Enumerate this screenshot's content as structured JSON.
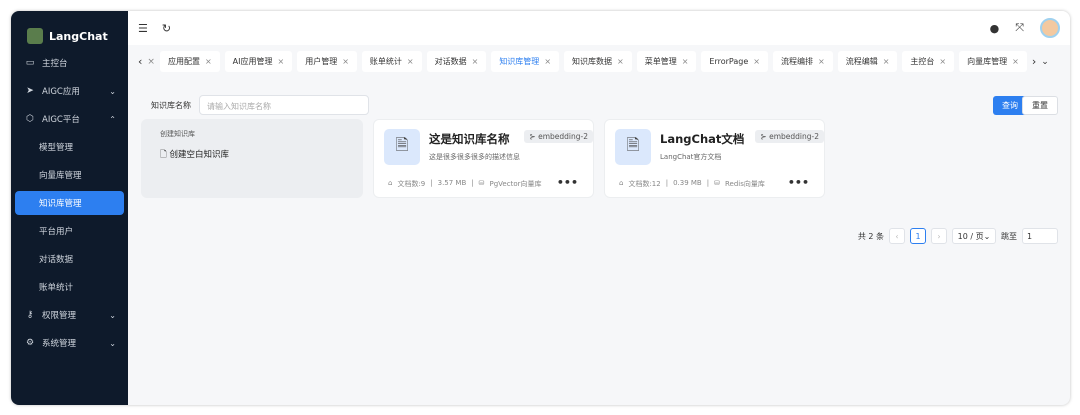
{
  "app": {
    "title": "LangChat"
  },
  "sidebar": {
    "items": [
      {
        "label": "主控台",
        "icon": "inbox-icon"
      },
      {
        "label": "AIGC应用",
        "icon": "send-icon",
        "chevron": "⌄"
      },
      {
        "label": "AIGC平台",
        "icon": "cube-icon",
        "chevron": "⌃"
      },
      {
        "label": "模型管理"
      },
      {
        "label": "向量库管理"
      },
      {
        "label": "知识库管理",
        "active": true
      },
      {
        "label": "平台用户"
      },
      {
        "label": "对话数据"
      },
      {
        "label": "账单统计"
      },
      {
        "label": "权限管理",
        "icon": "key-icon",
        "chevron": "⌄"
      },
      {
        "label": "系统管理",
        "icon": "gear-icon",
        "chevron": "⌄"
      }
    ]
  },
  "tabs": [
    "应用配置",
    "AI应用管理",
    "用户管理",
    "账单统计",
    "对话数据",
    "知识库管理",
    "知识库数据",
    "菜单管理",
    "ErrorPage",
    "流程编排",
    "流程编辑",
    "主控台",
    "向量库管理"
  ],
  "active_tab": "知识库管理",
  "search": {
    "label": "知识库名称",
    "placeholder": "请输入知识库名称",
    "query": "查询",
    "reset": "重置"
  },
  "create": {
    "title": "创建知识库",
    "action": "创建空白知识库"
  },
  "cards": [
    {
      "name": "这是知识库名称",
      "desc": "这是很多很多很多的描述信息",
      "model": "embedding-2",
      "docs": "文档数:9",
      "size": "3.57 MB",
      "store": "PgVector向量库"
    },
    {
      "name": "LangChat文档",
      "desc": "LangChat官方文档",
      "model": "embedding-2",
      "docs": "文档数:12",
      "size": "0.39 MB",
      "store": "Redis向量库"
    }
  ],
  "pager": {
    "total": "共 2 条",
    "page": "1",
    "size": "10 / 页",
    "jump": "跳至",
    "jump_value": "1"
  },
  "colors": {
    "accent": "#2d7ff0",
    "sidebar": "#0e1a2b"
  }
}
